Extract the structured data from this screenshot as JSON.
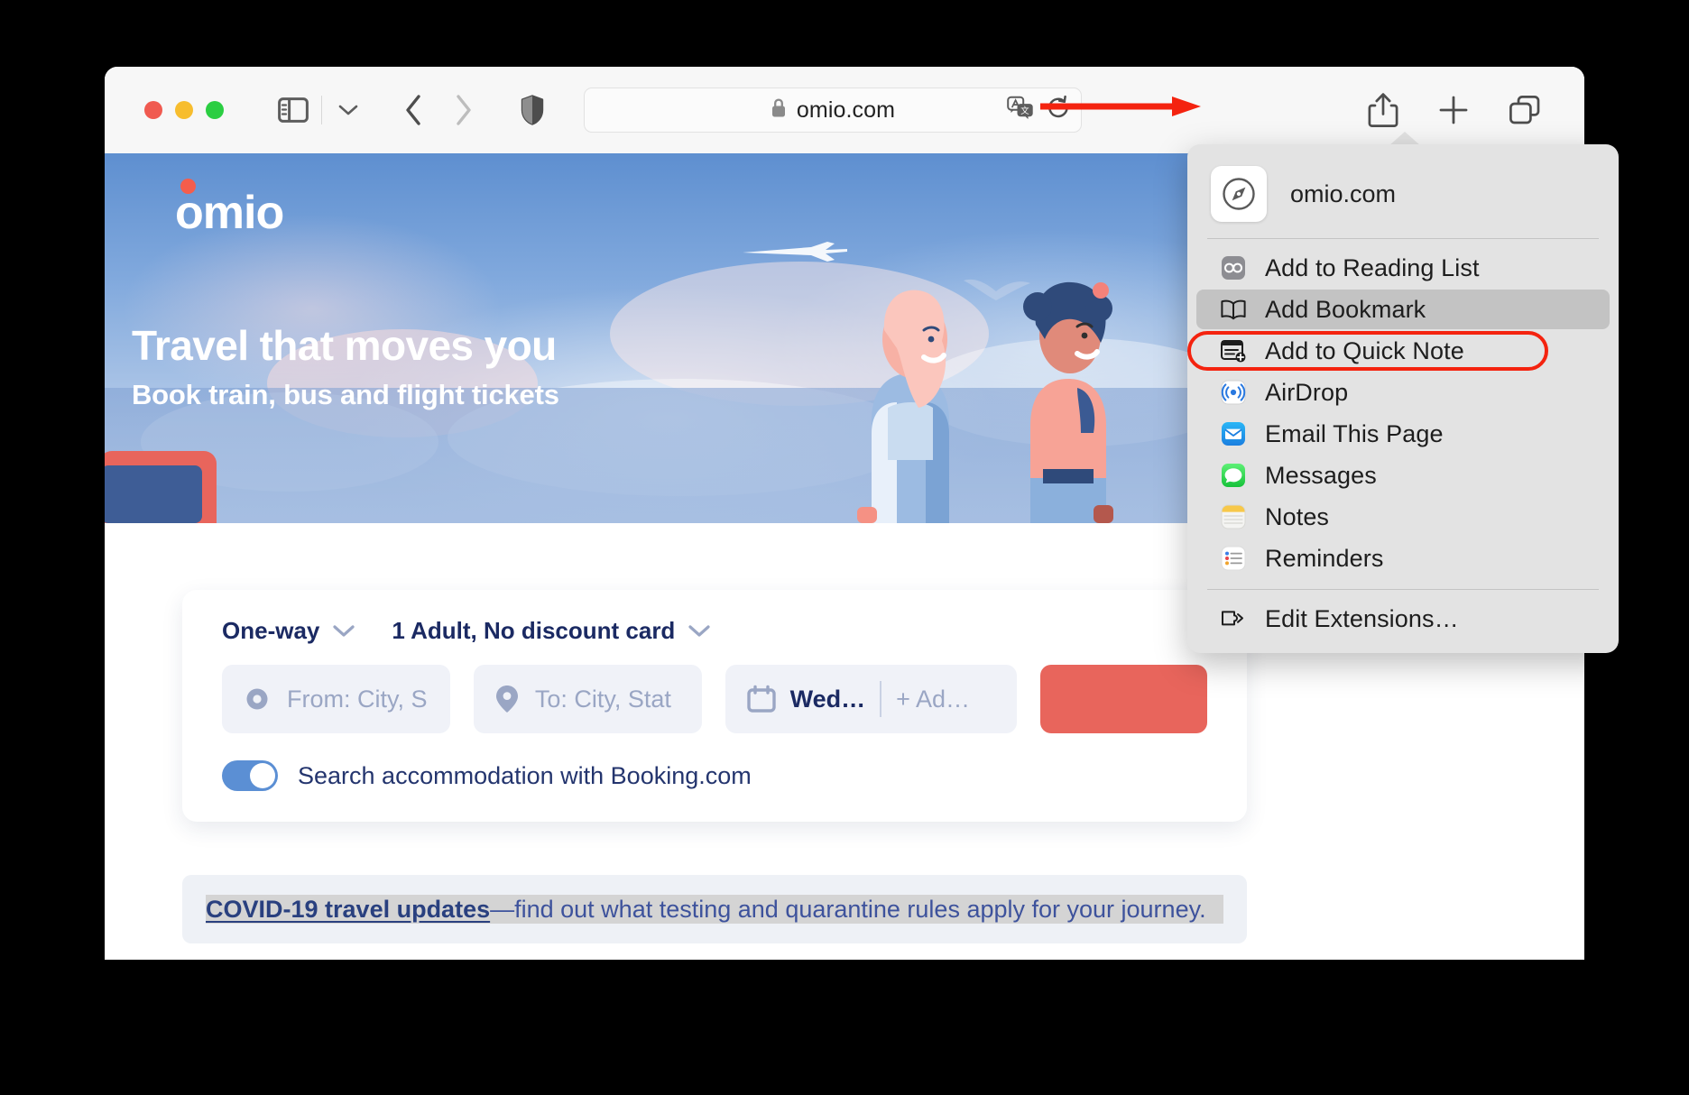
{
  "browser": {
    "traffic_lights": [
      "close",
      "minimize",
      "zoom"
    ],
    "sidebar_icon": "sidebar-icon",
    "tab_overview_chevron": "chevron-down-icon",
    "back_icon": "chevron-left-icon",
    "forward_icon": "chevron-right-icon",
    "shield_icon": "privacy-shield-icon",
    "address": {
      "lock_icon": "lock-icon",
      "url": "omio.com",
      "translate_icon": "translate-icon",
      "reload_icon": "reload-icon"
    },
    "share_icon": "share-icon",
    "new_tab_icon": "plus-icon",
    "tabs_icon": "tab-overview-icon",
    "annotation_arrow": "red-arrow-pointing-to-share"
  },
  "share_menu": {
    "favicon": "safari-compass-icon",
    "host": "omio.com",
    "items": [
      {
        "label": "Add to Reading List",
        "icon": "reading-glasses-icon",
        "selected": false
      },
      {
        "label": "Add Bookmark",
        "icon": "open-book-icon",
        "selected": true
      },
      {
        "label": "Add to Quick Note",
        "icon": "quick-note-icon",
        "selected": false
      },
      {
        "label": "AirDrop",
        "icon": "airdrop-icon",
        "selected": false
      },
      {
        "label": "Email This Page",
        "icon": "mail-icon",
        "selected": false
      },
      {
        "label": "Messages",
        "icon": "messages-icon",
        "selected": false
      },
      {
        "label": "Notes",
        "icon": "notes-icon",
        "selected": false
      },
      {
        "label": "Reminders",
        "icon": "reminders-icon",
        "selected": false
      }
    ],
    "footer_item": {
      "label": "Edit Extensions…",
      "icon": "extension-puzzle-icon"
    },
    "highlight_color": "#f4230f"
  },
  "site": {
    "logo_text": "omio",
    "hero": {
      "headline": "Travel that moves you",
      "subheadline": "Book train, bus and flight tickets"
    },
    "search": {
      "trip_type": "One-way",
      "trip_type_chevron": "chevron-down-icon",
      "passengers": "1 Adult, No discount card",
      "passengers_chevron": "chevron-down-icon",
      "from_icon": "origin-circle-icon",
      "from_placeholder": "From: City, S",
      "to_icon": "destination-pin-icon",
      "to_placeholder": "To: City, Stat",
      "date_icon": "calendar-icon",
      "date_value": "Wed…",
      "return_add": "+ Ad…",
      "search_button_label": "",
      "search_button_color": "#e8655c",
      "accommodation_toggle_on": true,
      "accommodation_label": "Search accommodation with Booking.com"
    },
    "banner": {
      "link_text": "COVID-19 travel updates",
      "rest_text": "—find out what testing and quarantine rules apply for your journey."
    }
  }
}
